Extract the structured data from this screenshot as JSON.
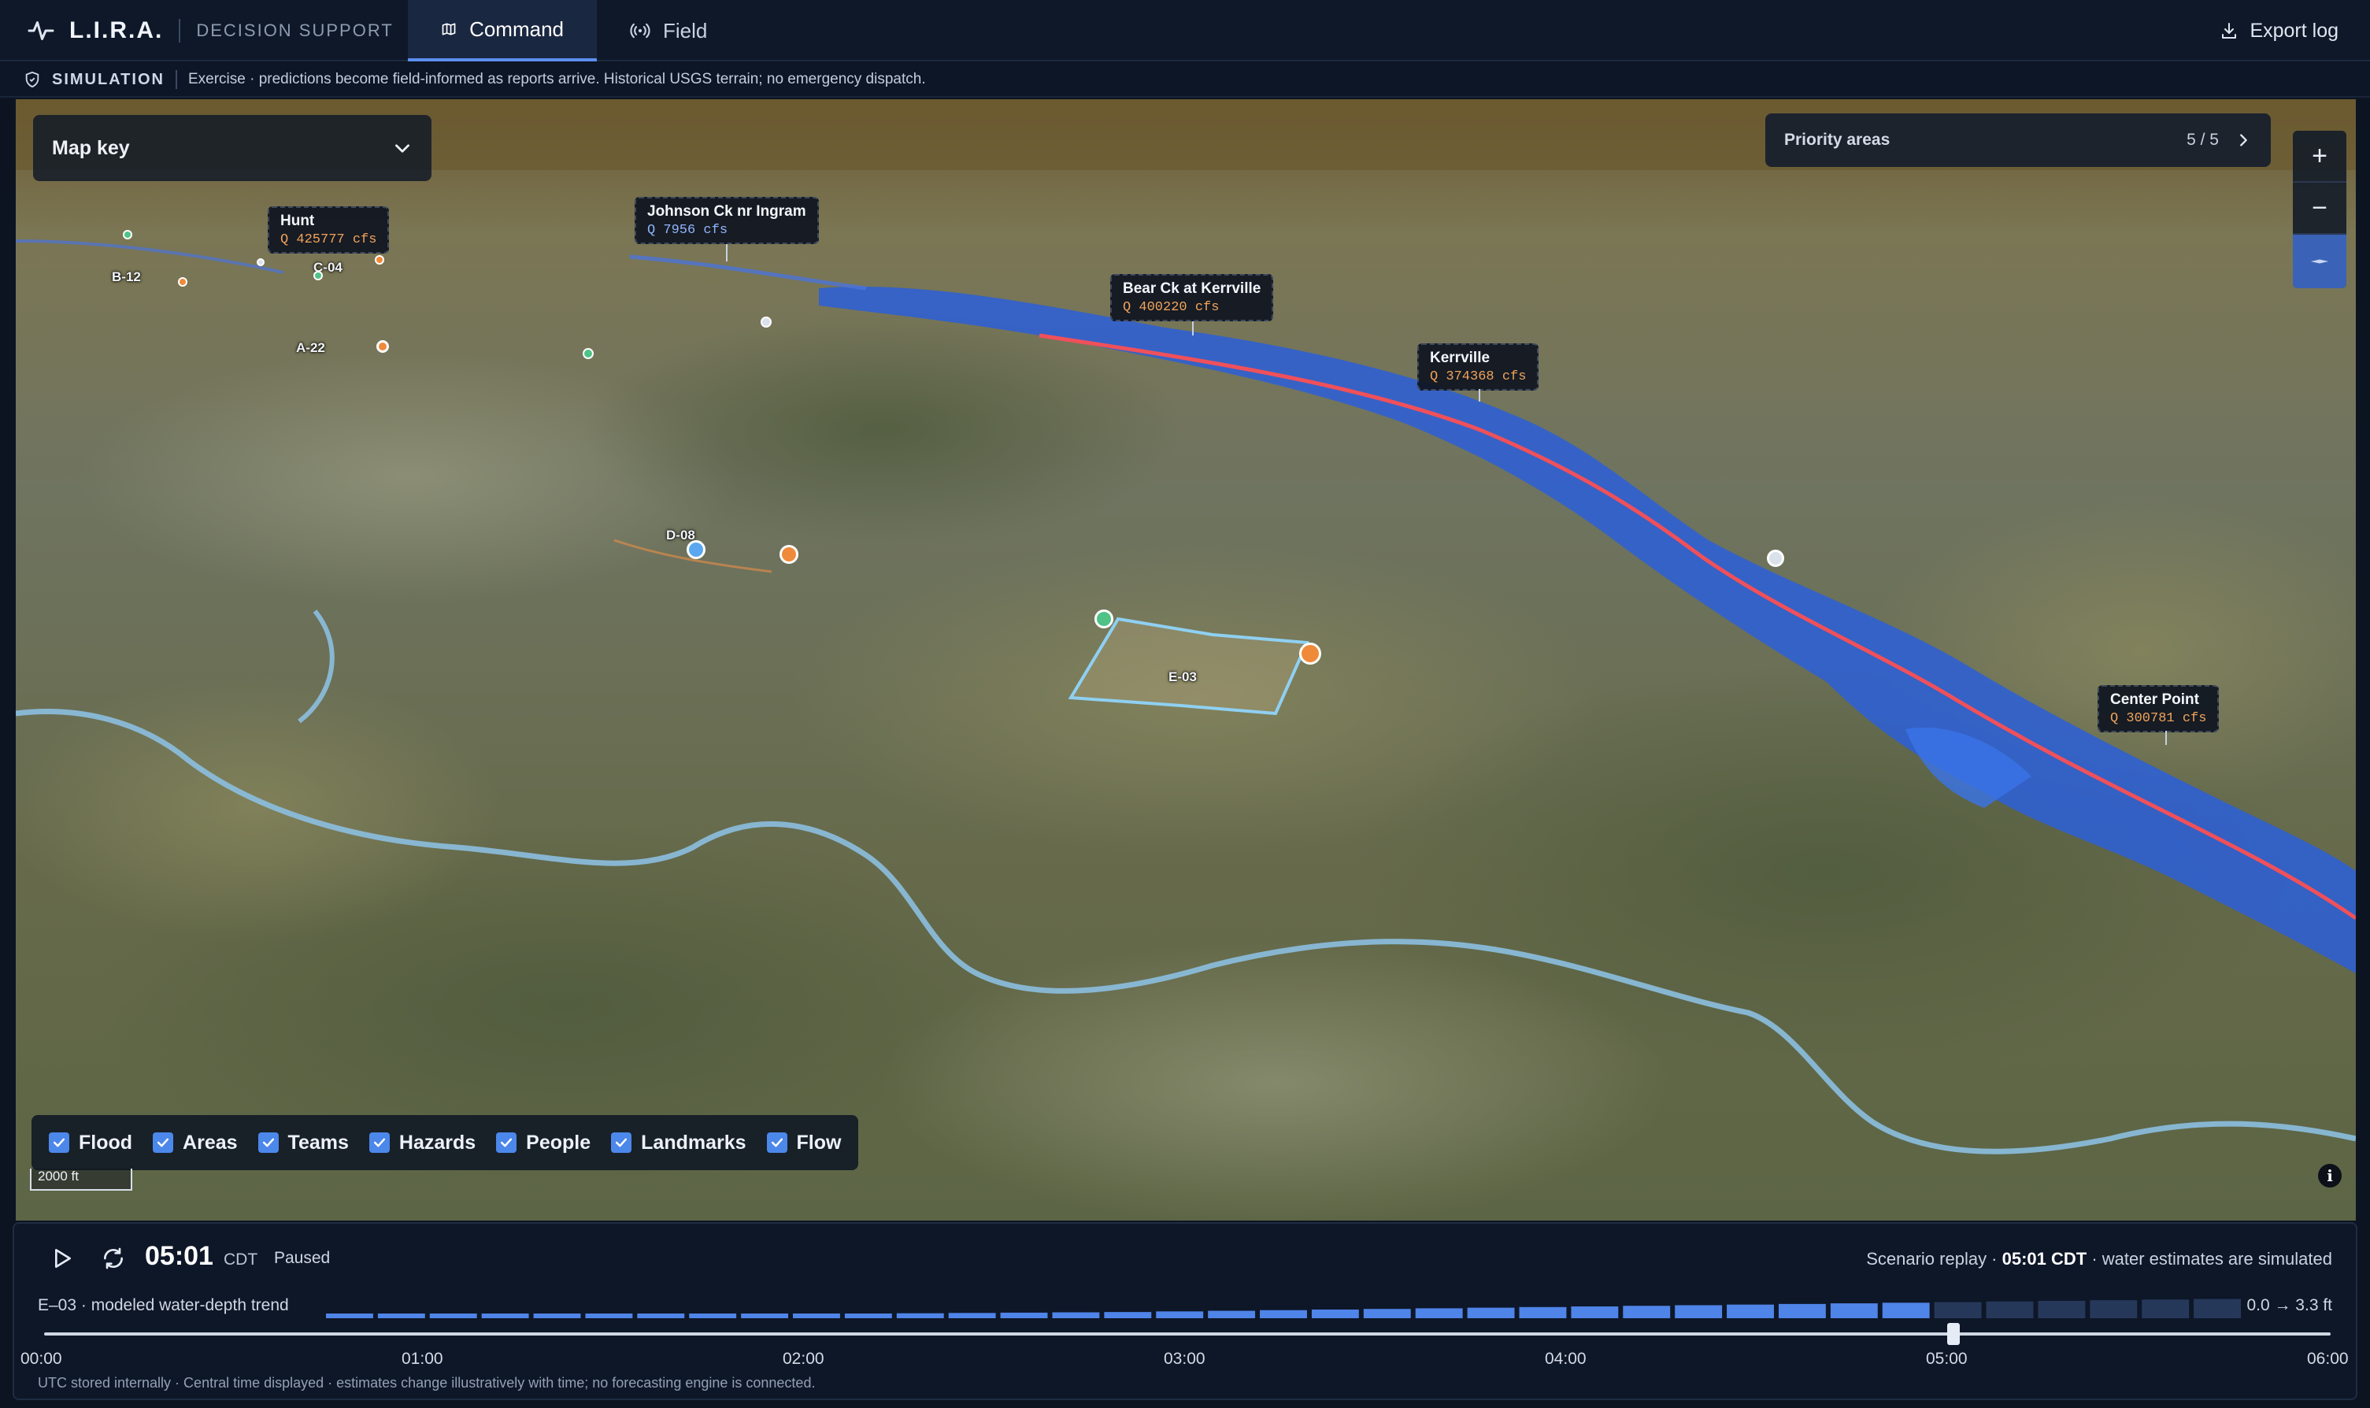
{
  "header": {
    "brand_name": "L.I.R.A.",
    "brand_sub": "DECISION SUPPORT",
    "tabs": [
      {
        "label": "Command",
        "icon": "map-icon",
        "active": true
      },
      {
        "label": "Field",
        "icon": "broadcast-icon",
        "active": false
      }
    ],
    "export_label": "Export log"
  },
  "banner": {
    "label": "SIMULATION",
    "text": "Exercise · predictions become field-informed as reports arrive. Historical USGS terrain; no emergency dispatch."
  },
  "map": {
    "key_label": "Map key",
    "priority_label": "Priority areas",
    "priority_count": "5 / 5",
    "zoom_in": "+",
    "zoom_out": "−",
    "gauges": [
      {
        "name": "Hunt",
        "q": "Q 425777 cfs",
        "color": "orange"
      },
      {
        "name": "Johnson Ck nr Ingram",
        "q": "Q 7956 cfs",
        "color": "blue"
      },
      {
        "name": "Bear Ck at Kerrville",
        "q": "Q 400220 cfs",
        "color": "orange"
      },
      {
        "name": "Kerrville",
        "q": "Q 374368 cfs",
        "color": "orange"
      },
      {
        "name": "Center Point",
        "q": "Q 300781 cfs",
        "color": "orange"
      }
    ],
    "area_labels": [
      "B-12",
      "C-04",
      "A-22",
      "D-08",
      "E-03"
    ],
    "layers": [
      "Flood",
      "Areas",
      "Teams",
      "Hazards",
      "People",
      "Landmarks",
      "Flow"
    ],
    "scale": "2000 ft",
    "info": "i",
    "colors": {
      "flood": "#2b5fd9",
      "flow_line": "#f0505a",
      "area_outline": "#8fd0f2",
      "accent": "#4c87ea"
    }
  },
  "timeline": {
    "clock": "05:01",
    "tz": "CDT",
    "state": "Paused",
    "replay_prefix": "Scenario replay · ",
    "replay_time": "05:01 CDT",
    "replay_suffix": " · water estimates are simulated",
    "trend_label": "E–03 · modeled water-depth trend",
    "range": "0.0 → 3.3 ft",
    "ticks": [
      "00:00",
      "01:00",
      "02:00",
      "03:00",
      "04:00",
      "05:00",
      "06:00"
    ],
    "progress": 0.835,
    "trend_values": [
      0.2,
      0.3,
      0.35,
      0.4,
      0.45,
      0.5,
      0.55,
      0.6,
      0.65,
      0.7,
      0.75,
      0.8,
      0.85,
      0.9,
      0.95,
      1.0,
      1.1,
      1.2,
      1.3,
      1.4,
      1.5,
      1.6,
      1.7,
      1.8,
      1.9,
      2.0,
      2.1,
      2.2,
      2.3,
      2.4,
      2.5,
      2.6,
      2.7,
      2.8,
      2.9,
      3.0,
      3.1
    ],
    "trend_elapsed_count": 31,
    "footnote": "UTC stored internally · Central time displayed · estimates change illustratively with time; no forecasting engine is connected."
  }
}
